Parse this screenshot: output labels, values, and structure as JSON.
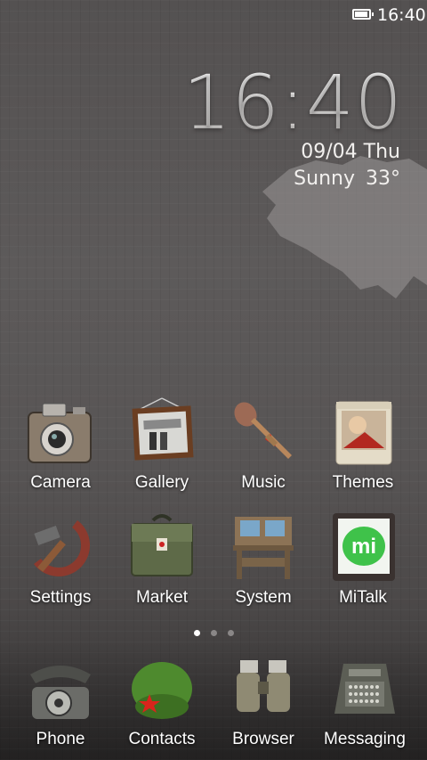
{
  "status_bar": {
    "time": "16:40",
    "battery_icon": "battery-icon",
    "battery_level": 0.85
  },
  "clock_widget": {
    "time": "16:40",
    "date": "09/04",
    "weekday": "Thu",
    "weather": "Sunny",
    "temperature": "33°"
  },
  "apps_row1": [
    {
      "label": "Camera",
      "icon": "camera-icon"
    },
    {
      "label": "Gallery",
      "icon": "gallery-icon"
    },
    {
      "label": "Music",
      "icon": "music-icon"
    },
    {
      "label": "Themes",
      "icon": "themes-icon"
    }
  ],
  "apps_row2": [
    {
      "label": "Settings",
      "icon": "settings-icon"
    },
    {
      "label": "Market",
      "icon": "market-icon"
    },
    {
      "label": "System",
      "icon": "system-icon"
    },
    {
      "label": "MiTalk",
      "icon": "mitalk-icon",
      "badge_text": "mi"
    }
  ],
  "page_indicator": {
    "pages": 3,
    "current": 1
  },
  "dock": [
    {
      "label": "Phone",
      "icon": "phone-icon"
    },
    {
      "label": "Contacts",
      "icon": "contacts-icon"
    },
    {
      "label": "Browser",
      "icon": "browser-icon"
    },
    {
      "label": "Messaging",
      "icon": "messaging-icon"
    }
  ],
  "colors": {
    "label_text": "#ffffff",
    "mitalk_green": "#3fc24a",
    "contacts_green": "#4e8a2e",
    "star_red": "#d8241c"
  }
}
